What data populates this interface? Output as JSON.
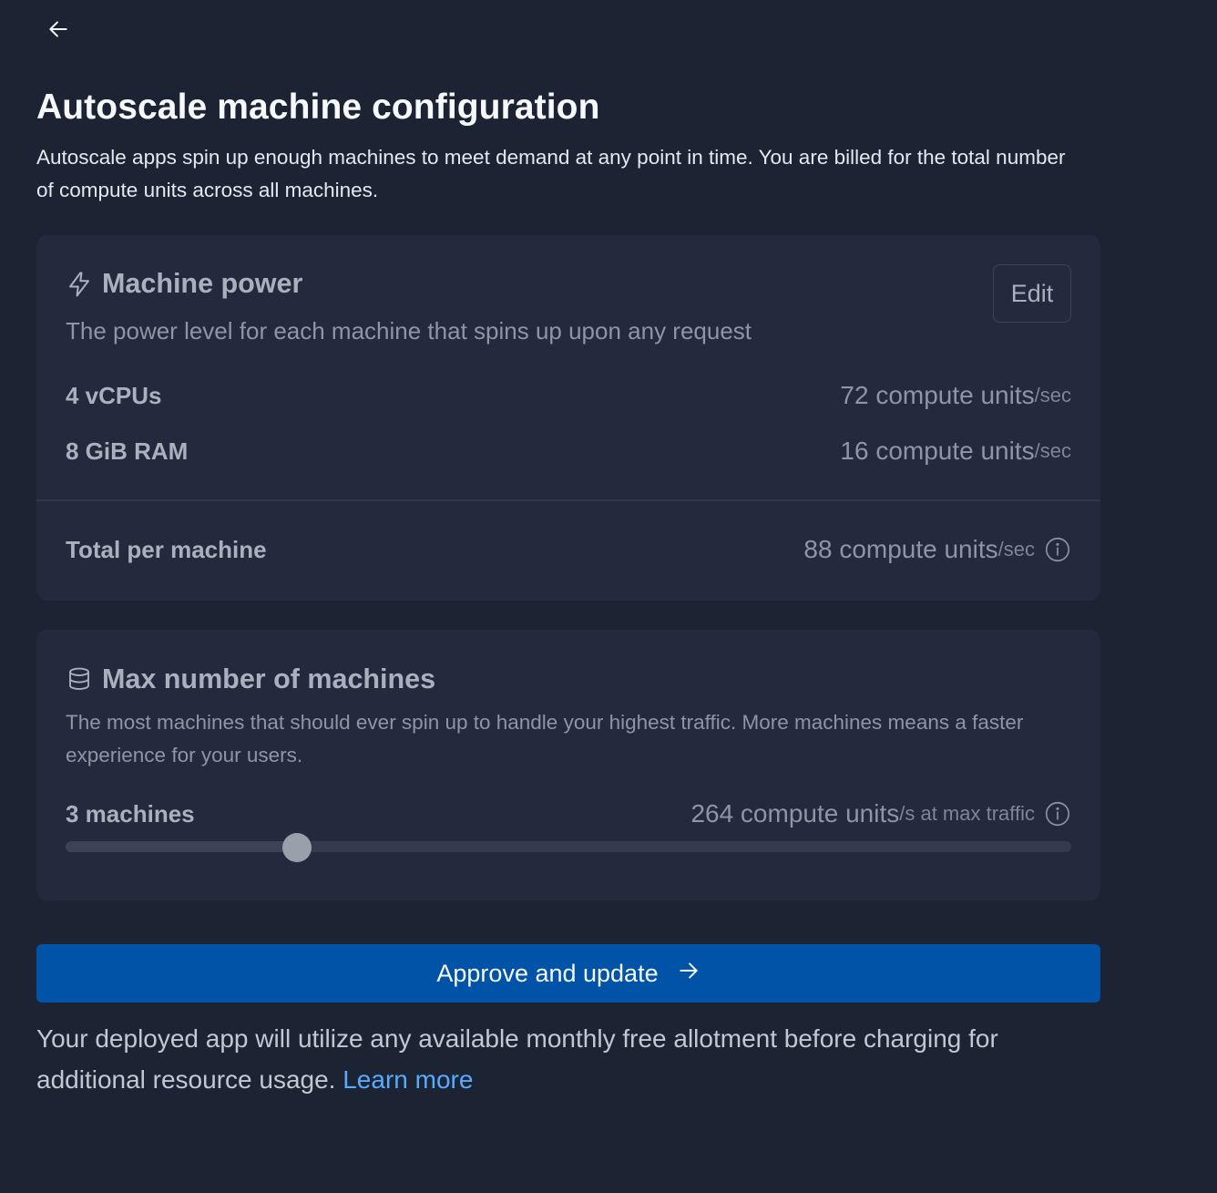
{
  "header": {
    "title": "Autoscale machine configuration",
    "description": "Autoscale apps spin up enough machines to meet demand at any point in time. You are billed for the total number of compute units across all machines."
  },
  "machine_power": {
    "icon": "lightning-icon",
    "title": "Machine power",
    "subtitle": "The power level for each machine that spins up upon any request",
    "edit_label": "Edit",
    "rows": [
      {
        "label": "4 vCPUs",
        "value": "72 compute units",
        "unit": "/sec"
      },
      {
        "label": "8 GiB RAM",
        "value": "16 compute units",
        "unit": "/sec"
      }
    ],
    "total": {
      "label": "Total per machine",
      "value": "88 compute units",
      "unit": "/sec"
    }
  },
  "max_machines": {
    "icon": "database-icon",
    "title": "Max number of machines",
    "subtitle": "The most machines that should ever spin up to handle your highest traffic. More machines means a faster experience for your users.",
    "count_label": "3 machines",
    "value": "264 compute units",
    "unit": "/s at max traffic",
    "slider_fraction": 0.23
  },
  "approve": {
    "label": "Approve and update"
  },
  "footer": {
    "text": "Your deployed app will utilize any available monthly free allotment before charging for additional resource usage.",
    "link_label": "Learn more"
  },
  "colors": {
    "background": "#1c2333",
    "card": "#232a3d",
    "primary_button": "#0053a6",
    "link": "#57abff"
  }
}
